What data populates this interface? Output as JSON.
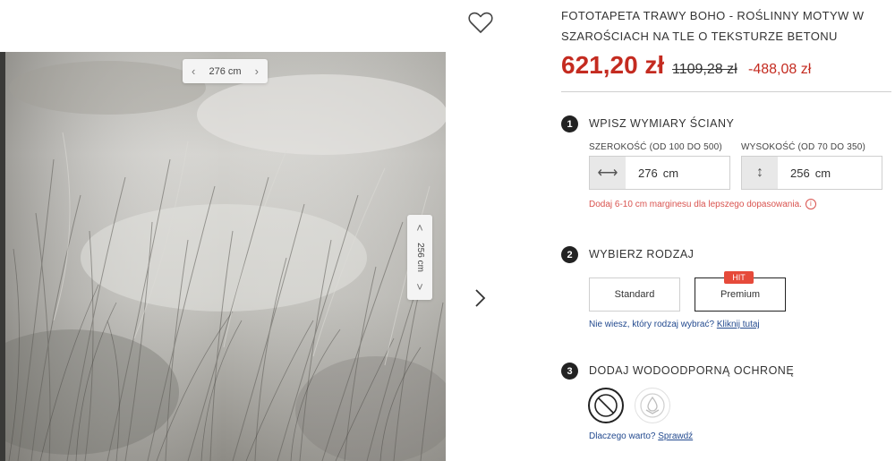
{
  "preview": {
    "width_label": "276 cm",
    "height_label": "256 cm"
  },
  "product": {
    "title": "FOTOTAPETA TRAWY BOHO - ROŚLINNY MOTYW W SZAROŚCIACH NA TLE O TEKSTURZE BETONU",
    "price": "621,20 zł",
    "old_price": "1109,28 zł",
    "discount": "-488,08 zł"
  },
  "step1": {
    "number": "1",
    "label": "WPISZ WYMIARY ŚCIANY",
    "width_label": "SZEROKOŚĆ (OD 100 DO 500)",
    "height_label": "WYSOKOŚĆ (OD 70 DO 350)",
    "width_value": "276",
    "height_value": "256",
    "unit": "cm",
    "hint": "Dodaj 6-10 cm marginesu dla lepszego dopasowania.",
    "info_glyph": "i"
  },
  "step2": {
    "number": "2",
    "label": "WYBIERZ RODZAJ",
    "options": [
      "Standard",
      "Premium"
    ],
    "selected": "Premium",
    "badge": "HIT",
    "help_text": "Nie wiesz, który rodzaj wybrać?",
    "help_link": "Kliknij tutaj"
  },
  "step3": {
    "number": "3",
    "label": "DODAJ WODOODPORNĄ OCHRONĘ",
    "help_text": "Dlaczego warto?",
    "help_link": "Sprawdź"
  },
  "icons": {
    "favorite": "heart-icon",
    "next": "chevron-right-icon",
    "width": "horizontal-arrows-icon",
    "height": "vertical-arrows-icon",
    "no_protection": "no-protection-icon",
    "protection": "water-drop-icon"
  },
  "colors": {
    "price": "#c42b20",
    "badge": "#e64a3a",
    "step_circle": "#222222",
    "link": "#234a8f"
  }
}
